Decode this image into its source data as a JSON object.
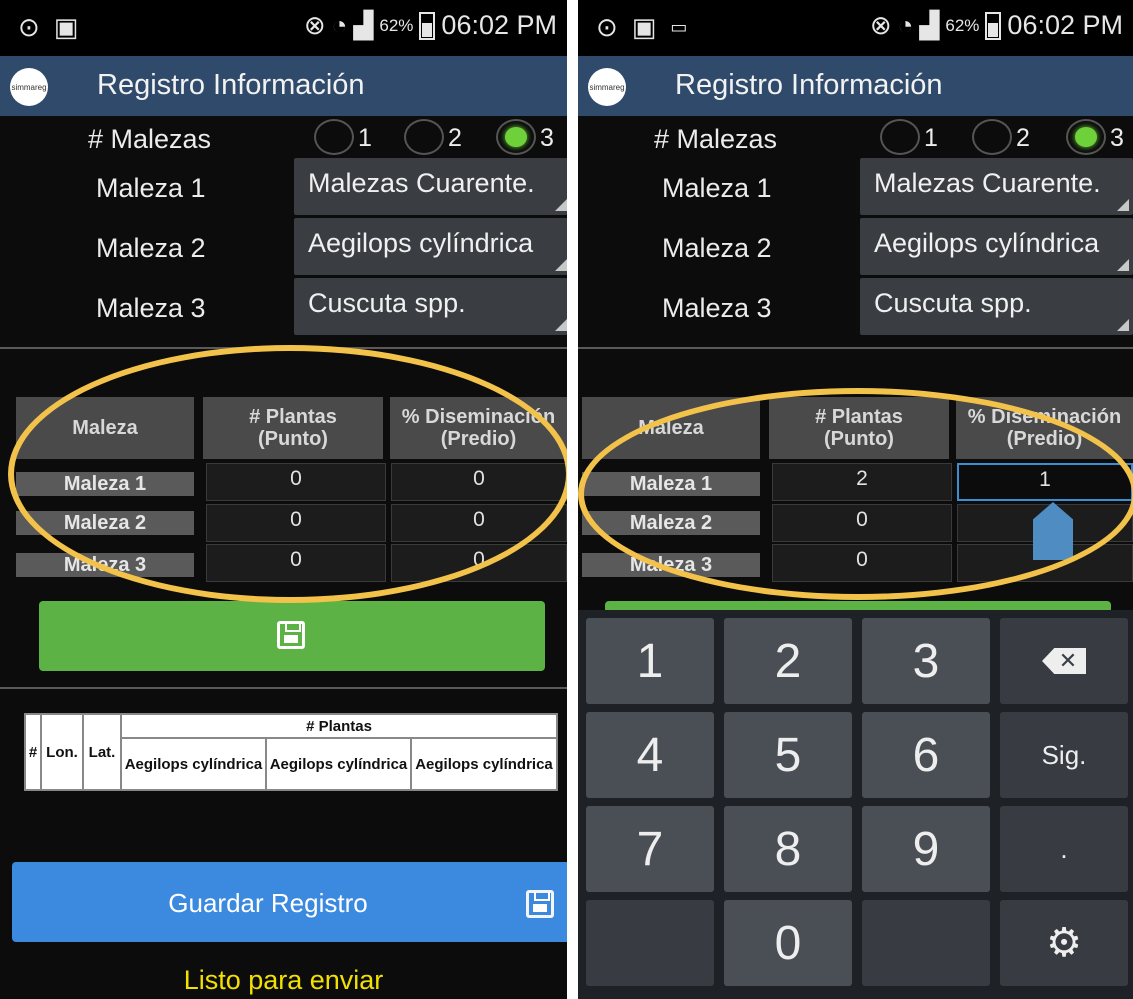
{
  "left": {
    "status": {
      "percent": "62%",
      "time": "06:02 PM"
    },
    "app": {
      "logo_text": "simmareg",
      "title": "Registro Información"
    },
    "malezas": {
      "label": "# Malezas",
      "options": [
        "1",
        "2",
        "3"
      ],
      "selected": "3"
    },
    "rows": [
      {
        "label": "Maleza 1",
        "value": "Malezas Cuarente."
      },
      {
        "label": "Maleza 2",
        "value": "Aegilops cylíndrica"
      },
      {
        "label": "Maleza 3",
        "value": "Cuscuta spp."
      }
    ],
    "table": {
      "headers": [
        "Maleza",
        "# Plantas\n(Punto)",
        "% Diseminación\n(Predio)"
      ],
      "rows": [
        {
          "name": "Maleza 1",
          "plantas": "0",
          "disem": "0"
        },
        {
          "name": "Maleza 2",
          "plantas": "0",
          "disem": "0"
        },
        {
          "name": "Maleza 3",
          "plantas": "0",
          "disem": "0"
        }
      ]
    },
    "summary": {
      "hash": "#",
      "lon": "Lon.",
      "lat": "Lat.",
      "group": "# Plantas",
      "columns": [
        "Aegilops cylíndrica",
        "Aegilops cylíndrica",
        "Aegilops cylíndrica"
      ]
    },
    "guardar_label": "Guardar Registro",
    "status_text": "Listo para enviar"
  },
  "right": {
    "status": {
      "percent": "62%",
      "time": "06:02 PM"
    },
    "app": {
      "logo_text": "simmareg",
      "title": "Registro Información"
    },
    "malezas": {
      "label": "# Malezas",
      "options": [
        "1",
        "2",
        "3"
      ],
      "selected": "3"
    },
    "rows": [
      {
        "label": "Maleza 1",
        "value": "Malezas Cuarente."
      },
      {
        "label": "Maleza 2",
        "value": "Aegilops cylíndrica"
      },
      {
        "label": "Maleza 3",
        "value": "Cuscuta spp."
      }
    ],
    "table": {
      "headers": [
        "Maleza",
        "# Plantas\n(Punto)",
        "% Diseminación\n(Predio)"
      ],
      "rows": [
        {
          "name": "Maleza 1",
          "plantas": "2",
          "disem": "1"
        },
        {
          "name": "Maleza 2",
          "plantas": "0",
          "disem": ""
        },
        {
          "name": "Maleza 3",
          "plantas": "0",
          "disem": ""
        }
      ]
    },
    "keyboard": {
      "keys": [
        "1",
        "2",
        "3",
        "",
        "4",
        "5",
        "6",
        "Sig.",
        "7",
        "8",
        "9",
        ".",
        "",
        "0",
        "",
        ""
      ]
    }
  },
  "colors": {
    "accent_green": "#5cb245",
    "action_bar": "#2f4a6a",
    "guardar_blue": "#3b8ae0",
    "highlight_yellow": "#f2c24a",
    "status_yellow": "#f2e000"
  }
}
